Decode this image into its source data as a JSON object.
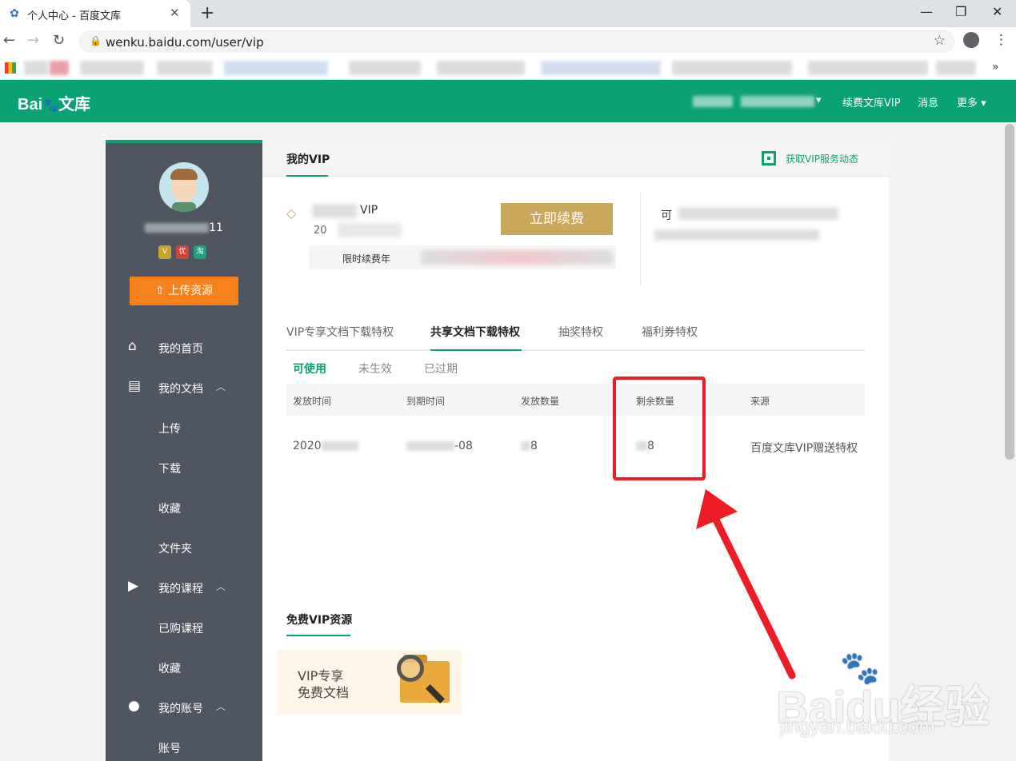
{
  "browser": {
    "tab_title": "个人中心 - 百度文库",
    "url": "wenku.baidu.com/user/vip"
  },
  "header": {
    "logo_text": "Bai",
    "logo_suffix": "文库",
    "links": [
      "续费文库VIP",
      "消息",
      "更多"
    ]
  },
  "sidebar": {
    "username_suffix": "11",
    "badges": [
      "V",
      "优",
      "淘"
    ],
    "upload_label": "上传资源",
    "menu": [
      {
        "label": "我的首页",
        "icon": "home-icon"
      },
      {
        "label": "我的文档",
        "icon": "document-icon"
      },
      {
        "label": "我的课程",
        "icon": "video-icon"
      },
      {
        "label": "我的账号",
        "icon": "user-icon"
      }
    ],
    "doc_sub": [
      "上传",
      "下载",
      "收藏",
      "文件夹"
    ],
    "course_sub": [
      "已购课程",
      "收藏"
    ],
    "account_sub": [
      "账号"
    ]
  },
  "main": {
    "title": "我的VIP",
    "dynamic_link": "获取VIP服务动态",
    "vip_suffix": "VIP",
    "vip_date_prefix": "20",
    "renew_label": "立即续费",
    "promo_text": "限时续费年",
    "right_text_prefix": "可"
  },
  "tabs": [
    "VIP专享文档下载特权",
    "共享文档下载特权",
    "抽奖特权",
    "福利券特权"
  ],
  "subtabs": [
    "可使用",
    "未生效",
    "已过期"
  ],
  "table": {
    "headers": [
      "发放时间",
      "到期时间",
      "发放数量",
      "剩余数量",
      "来源"
    ],
    "row": {
      "issue_time_prefix": "2020",
      "expire_suffix": "-08",
      "issued_suffix": "8",
      "remaining_suffix": "8",
      "source": "百度文库VIP赠送特权"
    }
  },
  "free": {
    "title": "免费VIP资源",
    "card_line1": "VIP专享",
    "card_line2": "免费文档"
  },
  "watermark": {
    "main": "Baidu经验",
    "sub": "jingyan.baidu.com"
  },
  "colors": {
    "brand_green": "#0aa173",
    "sidebar": "#4f5661",
    "upload_orange": "#f7811b",
    "gold": "#c9a85a",
    "annotation_red": "#ee1c25"
  }
}
